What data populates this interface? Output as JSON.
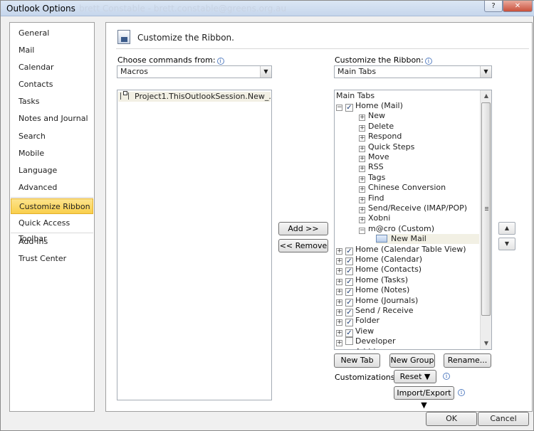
{
  "window": {
    "title": "Outlook Options",
    "ghost_title": "brett Constable - brett.constable@greens.org.au",
    "help_label": "?",
    "close_label": "✕"
  },
  "nav": {
    "items": [
      {
        "label": "General"
      },
      {
        "label": "Mail"
      },
      {
        "label": "Calendar"
      },
      {
        "label": "Contacts"
      },
      {
        "label": "Tasks"
      },
      {
        "label": "Notes and Journal"
      },
      {
        "label": "Search"
      },
      {
        "label": "Mobile"
      },
      {
        "label": "Language"
      },
      {
        "label": "Advanced"
      },
      {
        "label": "Customize Ribbon",
        "selected": true
      },
      {
        "label": "Quick Access Toolbar"
      },
      {
        "label": "Add-Ins"
      },
      {
        "label": "Trust Center"
      }
    ]
  },
  "header": {
    "title": "Customize the Ribbon."
  },
  "left_panel": {
    "label": "Choose commands from:",
    "combo_value": "Macros",
    "items": [
      {
        "label": "Project1.ThisOutlookSession.New_...",
        "icon": "macro-icon",
        "selected": true
      }
    ]
  },
  "right_panel": {
    "label": "Customize the Ribbon:",
    "combo_value": "Main Tabs",
    "tree_header": "Main Tabs",
    "tree": [
      {
        "label": "Home (Mail)",
        "level": 0,
        "expander": "−",
        "checked": true
      },
      {
        "label": "New",
        "level": 1,
        "expander": "+"
      },
      {
        "label": "Delete",
        "level": 1,
        "expander": "+"
      },
      {
        "label": "Respond",
        "level": 1,
        "expander": "+"
      },
      {
        "label": "Quick Steps",
        "level": 1,
        "expander": "+"
      },
      {
        "label": "Move",
        "level": 1,
        "expander": "+"
      },
      {
        "label": "RSS",
        "level": 1,
        "expander": "+"
      },
      {
        "label": "Tags",
        "level": 1,
        "expander": "+"
      },
      {
        "label": "Chinese Conversion",
        "level": 1,
        "expander": "+"
      },
      {
        "label": "Find",
        "level": 1,
        "expander": "+"
      },
      {
        "label": "Send/Receive (IMAP/POP)",
        "level": 1,
        "expander": "+"
      },
      {
        "label": "Xobni",
        "level": 1,
        "expander": "+"
      },
      {
        "label": "m@cro (Custom)",
        "level": 1,
        "expander": "−"
      },
      {
        "label": "New Mail",
        "level": 2,
        "icon": "tab-icon",
        "selected": true
      },
      {
        "label": "Home (Calendar Table View)",
        "level": 0,
        "expander": "+",
        "checked": true
      },
      {
        "label": "Home (Calendar)",
        "level": 0,
        "expander": "+",
        "checked": true
      },
      {
        "label": "Home (Contacts)",
        "level": 0,
        "expander": "+",
        "checked": true
      },
      {
        "label": "Home (Tasks)",
        "level": 0,
        "expander": "+",
        "checked": true
      },
      {
        "label": "Home (Notes)",
        "level": 0,
        "expander": "+",
        "checked": true
      },
      {
        "label": "Home (Journals)",
        "level": 0,
        "expander": "+",
        "checked": true
      },
      {
        "label": "Send / Receive",
        "level": 0,
        "expander": "+",
        "checked": true
      },
      {
        "label": "Folder",
        "level": 0,
        "expander": "+",
        "checked": true
      },
      {
        "label": "View",
        "level": 0,
        "expander": "+",
        "checked": true
      },
      {
        "label": "Developer",
        "level": 0,
        "expander": "+",
        "checked": false
      },
      {
        "label": "Add-Ins",
        "level": 0,
        "expander": "+",
        "checked": true
      }
    ]
  },
  "middle": {
    "add_label": "Add >>",
    "remove_label": "<< Remove"
  },
  "bottom": {
    "new_tab_label": "New Tab",
    "new_group_label": "New Group",
    "rename_label": "Rename...",
    "customizations_label": "Customizations:",
    "reset_label": "Reset ▼",
    "import_export_label": "Import/Export ▼"
  },
  "footer": {
    "ok_label": "OK",
    "cancel_label": "Cancel"
  },
  "move_up_label": "▲",
  "move_down_label": "▼"
}
